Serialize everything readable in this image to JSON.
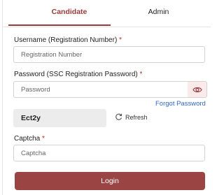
{
  "tabs": {
    "candidate": "Candidate",
    "admin": "Admin"
  },
  "username": {
    "label": "Username (Registration Number)",
    "required_mark": "*",
    "placeholder": "Registration Number"
  },
  "password": {
    "label": "Password (SSC Registration Password)",
    "required_mark": "*",
    "placeholder": "Password",
    "toggle_icon": "eye-icon"
  },
  "forgot_password": "Forgot Password",
  "captcha": {
    "code": "Ect2y",
    "refresh_label": "Refresh",
    "refresh_icon": "refresh-icon",
    "label": "Captcha",
    "required_mark": "*",
    "placeholder": "Captcha"
  },
  "login_button": "Login",
  "colors": {
    "accent": "#9b4444",
    "link": "#2f66c4",
    "required": "#c62828"
  }
}
